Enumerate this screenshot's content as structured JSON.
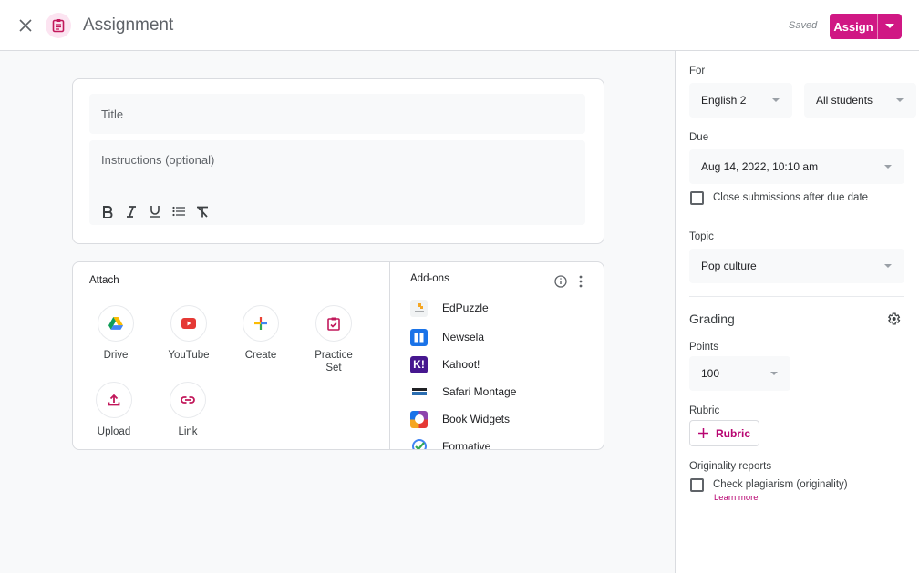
{
  "header": {
    "title": "Assignment",
    "status": "Saved",
    "assign_label": "Assign",
    "accent_color": "#d01884"
  },
  "editor": {
    "title_placeholder": "Title",
    "instructions_placeholder": "Instructions (optional)",
    "format_tools": [
      "bold",
      "italic",
      "underline",
      "bulleted-list",
      "clear-formatting"
    ]
  },
  "attach": {
    "label": "Attach",
    "items": [
      {
        "label": "Drive",
        "icon": "google-drive-icon"
      },
      {
        "label": "YouTube",
        "icon": "youtube-icon"
      },
      {
        "label": "Create",
        "icon": "plus-icon"
      },
      {
        "label": "Practice Set",
        "icon": "practice-set-icon"
      },
      {
        "label": "Upload",
        "icon": "upload-icon"
      },
      {
        "label": "Link",
        "icon": "link-icon"
      }
    ]
  },
  "addons": {
    "label": "Add-ons",
    "items": [
      {
        "name": "EdPuzzle",
        "color": "#f5a623"
      },
      {
        "name": "Newsela",
        "color": "#1a73e8"
      },
      {
        "name": "Kahoot!",
        "color": "#46178f"
      },
      {
        "name": "Safari Montage",
        "color": "#2a6db0"
      },
      {
        "name": "Book Widgets",
        "color": "#e8710a"
      },
      {
        "name": "Formative",
        "color": "#4285f4"
      }
    ]
  },
  "sidebar": {
    "for_label": "For",
    "class_value": "English 2",
    "students_value": "All students",
    "due_label": "Due",
    "due_value": "Aug 14, 2022, 10:10 am",
    "close_submissions_label": "Close submissions after due date",
    "close_submissions_checked": false,
    "topic_label": "Topic",
    "topic_value": "Pop culture",
    "grading_title": "Grading",
    "points_label": "Points",
    "points_value": "100",
    "rubric_label": "Rubric",
    "rubric_button": "Rubric",
    "originality_label": "Originality reports",
    "plagiarism_label": "Check plagiarism (originality)",
    "plagiarism_checked": false,
    "learn_more": "Learn more"
  }
}
